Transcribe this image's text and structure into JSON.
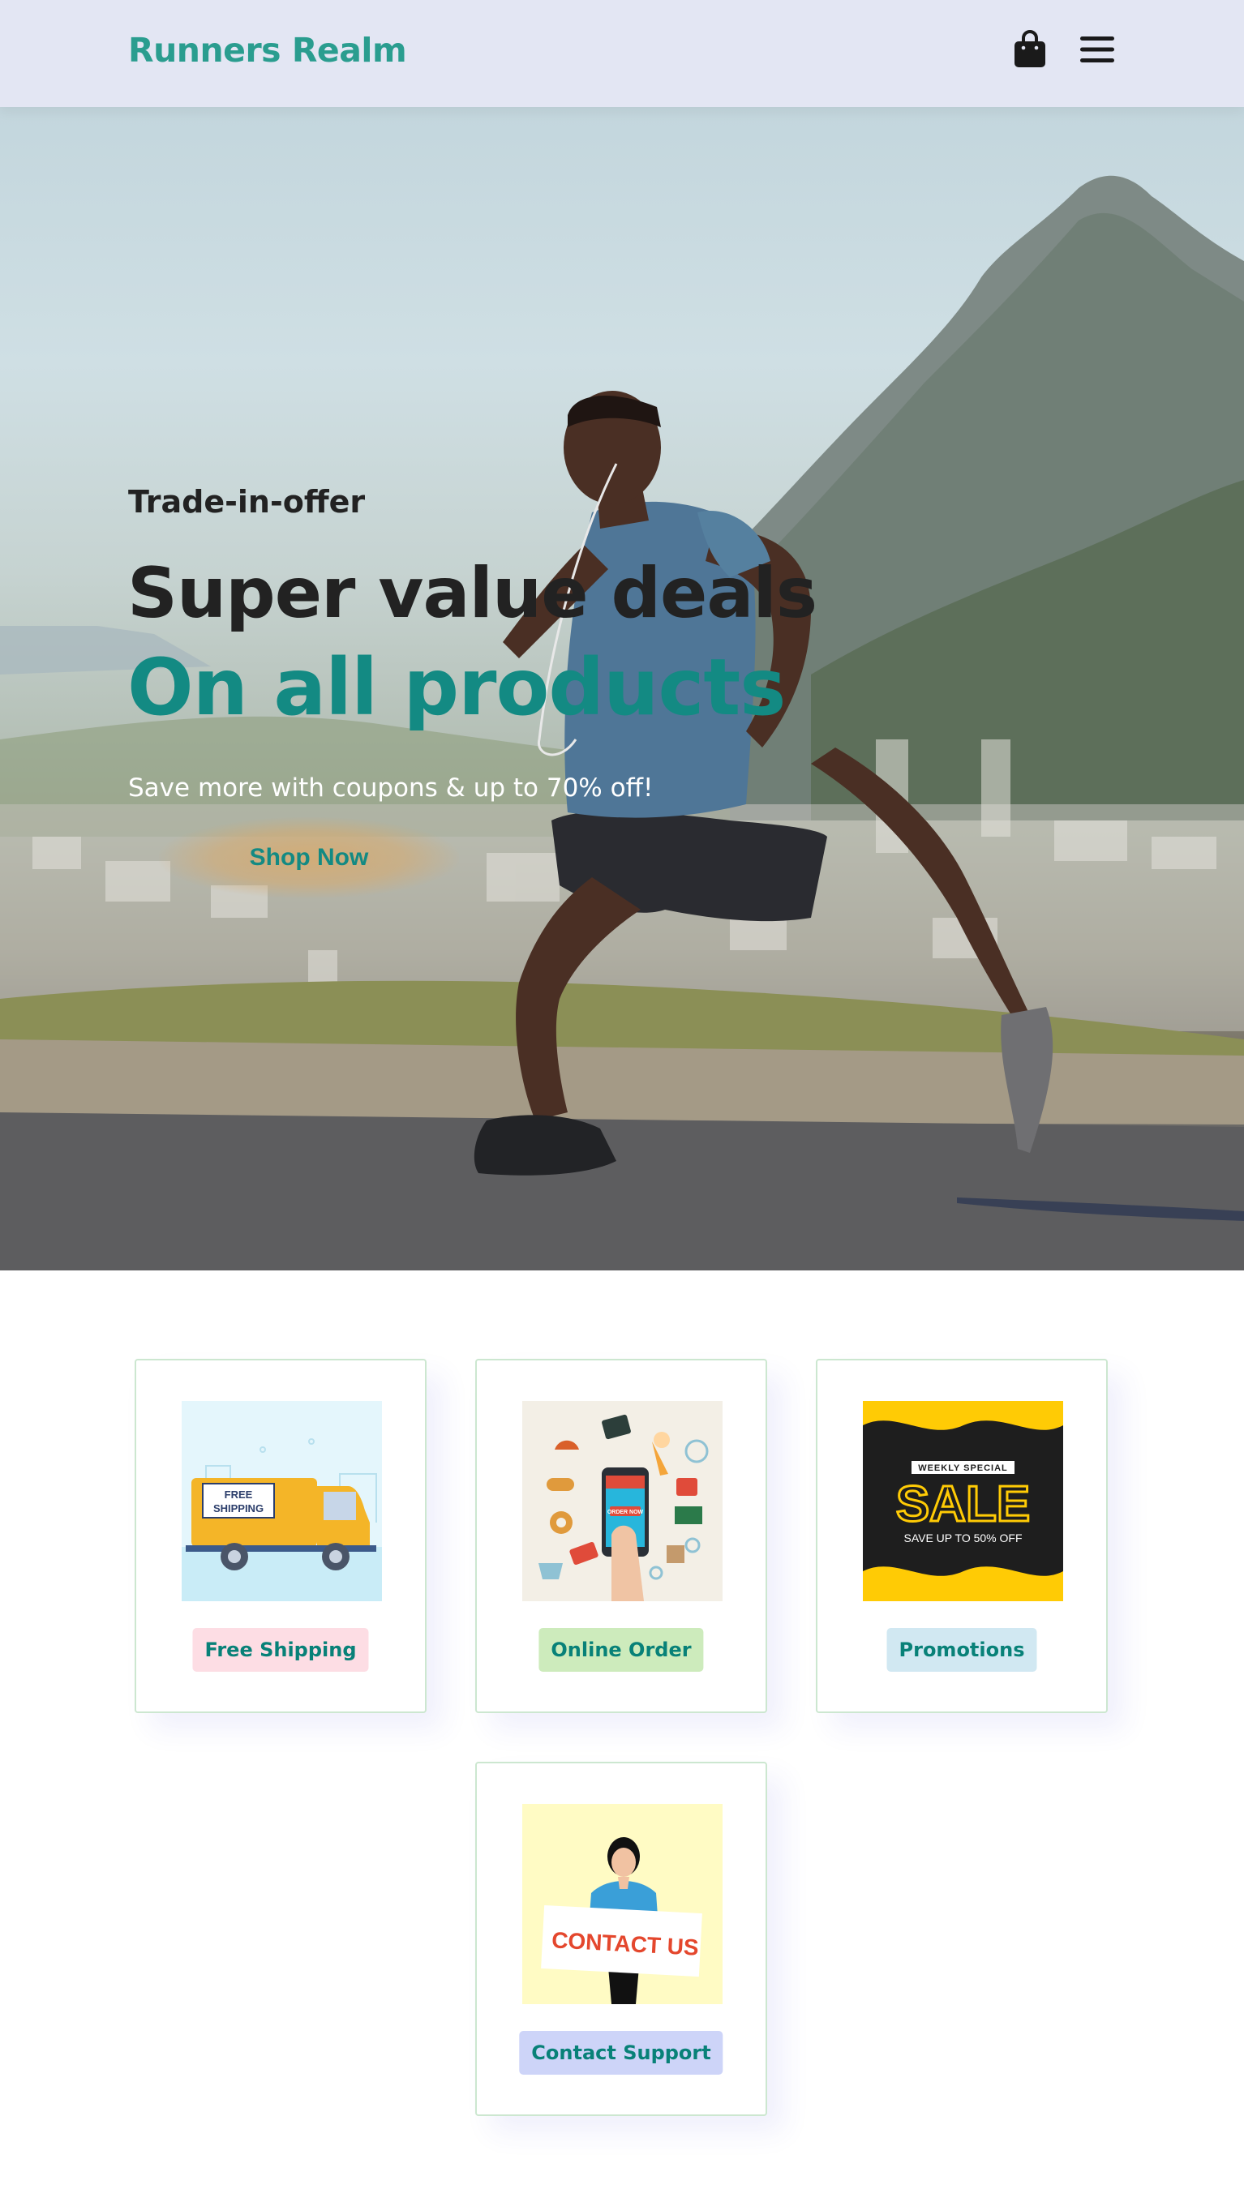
{
  "header": {
    "logo_text": "Runners Realm",
    "icons": [
      "shopping-bag-icon",
      "hamburger-menu-icon"
    ]
  },
  "hero": {
    "subtitle": "Trade-in-offer",
    "title_line1": "Super value deals",
    "title_line2": "On all products",
    "description": "Save more with coupons & up to 70% off!",
    "button_label": "Shop Now"
  },
  "features": [
    {
      "label": "Free Shipping",
      "image_text": [
        "FREE",
        "SHIPPING"
      ],
      "label_bg": "#fddde4"
    },
    {
      "label": "Online Order",
      "image_text": [
        "ORDER NOW"
      ],
      "label_bg": "#cdebbc"
    },
    {
      "label": "Promotions",
      "image_text": [
        "WEEKLY SPECIAL",
        "SALE",
        "SAVE UP TO 50% OFF"
      ],
      "label_bg": "#d1e8f2"
    },
    {
      "label": "Contact Support",
      "image_text": [
        "CONTACT US"
      ],
      "label_bg": "#cdd4f8"
    }
  ],
  "colors": {
    "accent": "#2a9d8f",
    "accent_dark": "#138a83",
    "header_bg": "#e3e6f3",
    "card_border": "#cce7d0"
  }
}
